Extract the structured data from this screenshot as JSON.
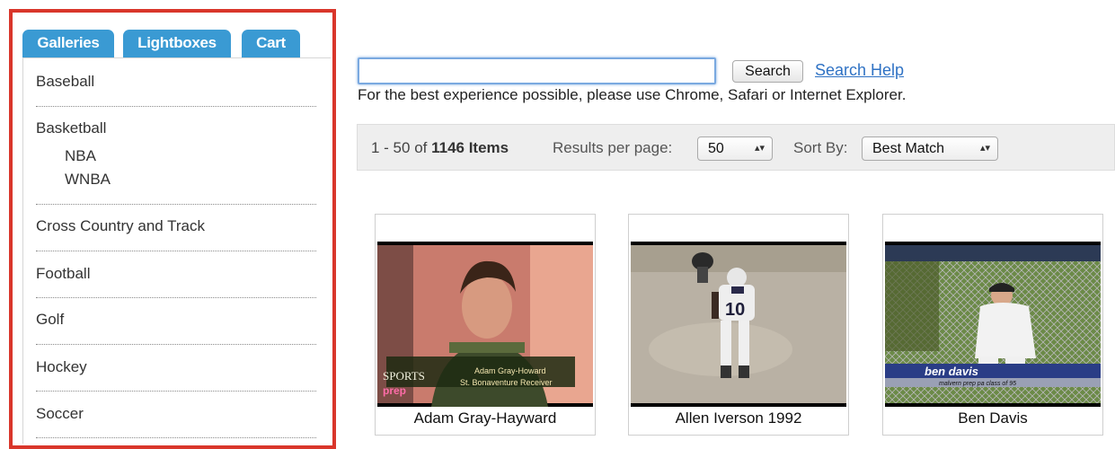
{
  "tabs": [
    "Galleries",
    "Lightboxes",
    "Cart"
  ],
  "sidebar": {
    "categories": [
      {
        "label": "Baseball"
      },
      {
        "label": "Basketball",
        "children": [
          "NBA",
          "WNBA"
        ]
      },
      {
        "label": "Cross Country and Track"
      },
      {
        "label": "Football"
      },
      {
        "label": "Golf"
      },
      {
        "label": "Hockey"
      },
      {
        "label": "Soccer"
      }
    ]
  },
  "search": {
    "value": "",
    "button_label": "Search",
    "help_link": "Search Help",
    "notice": "For the best experience possible, please use Chrome, Safari or Internet Explorer."
  },
  "results": {
    "range": "1 - 50 of",
    "count": "1146 Items",
    "per_page_label": "Results per page:",
    "per_page_value": "50",
    "sort_label": "Sort By:",
    "sort_value": "Best Match"
  },
  "items": [
    {
      "caption": "Adam Gray-Hayward",
      "overlay_line1": "Adam Gray-Howard",
      "overlay_line2": "St. Bonaventure Receiver",
      "brand": "SPORTS",
      "brand2": "prep"
    },
    {
      "caption": "Allen Iverson 1992",
      "jersey": "10"
    },
    {
      "caption": "Ben Davis",
      "overlay_line1": "ben davis",
      "overlay_line2": "malvern prep pa  class of 95"
    }
  ],
  "colors": {
    "accent_tab": "#3a9ad3",
    "highlight_frame": "#d9362b",
    "link": "#2f72c4"
  }
}
